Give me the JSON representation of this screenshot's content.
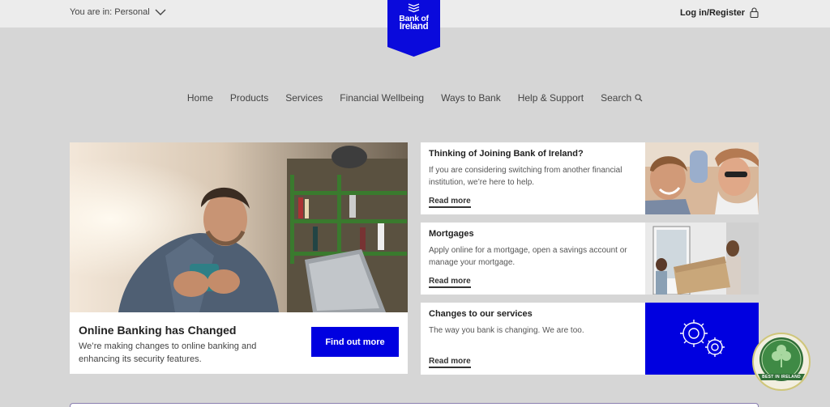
{
  "header": {
    "context_label": "You are in: Personal",
    "login_label": "Log in/Register",
    "logo_text_line1": "Bank of",
    "logo_text_line2": "Ireland"
  },
  "nav": {
    "items": [
      {
        "label": "Home"
      },
      {
        "label": "Products"
      },
      {
        "label": "Services"
      },
      {
        "label": "Financial Wellbeing"
      },
      {
        "label": "Ways to Bank"
      },
      {
        "label": "Help & Support"
      },
      {
        "label": "Search"
      }
    ]
  },
  "hero": {
    "title": "Online Banking has Changed",
    "description": "We’re making changes to online banking and enhancing its security features.",
    "button_label": "Find out more"
  },
  "cards": [
    {
      "title": "Thinking of Joining Bank of Ireland?",
      "description": "If you are considering switching from another financial institution, we’re here to help.",
      "link_label": "Read more",
      "image": "couple-photo"
    },
    {
      "title": "Mortgages",
      "description": "Apply online for a mortgage, open a savings account or manage your mortgage.",
      "link_label": "Read more",
      "image": "moving-box-photo"
    },
    {
      "title": "Changes to our services",
      "description": "The way you bank is changing. We are too.",
      "link_label": "Read more",
      "image": "gears-icon"
    }
  ],
  "badge": {
    "text": "BEST IN IRELAND"
  },
  "colors": {
    "brand_blue": "#0000e0",
    "logo_blue": "#0a0adc",
    "page_bg": "#d6d6d6"
  }
}
